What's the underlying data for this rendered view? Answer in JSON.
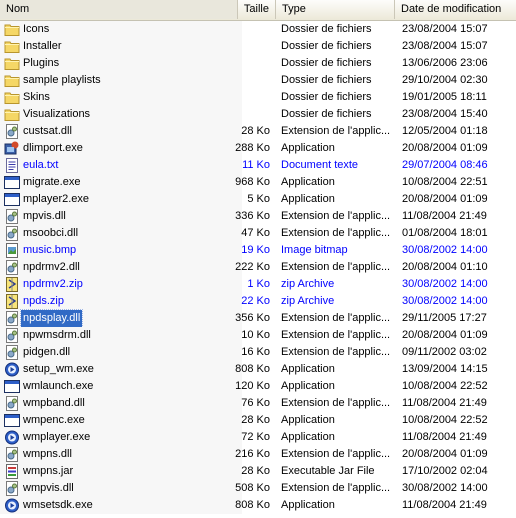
{
  "header": {
    "name": "Nom",
    "size": "Taille",
    "type": "Type",
    "date": "Date de modification"
  },
  "rows": [
    {
      "name": "Icons",
      "size": "",
      "type": "Dossier de fichiers",
      "date": "23/08/2004 15:07",
      "icon": "folder-icon",
      "blue": false,
      "selected": false
    },
    {
      "name": "Installer",
      "size": "",
      "type": "Dossier de fichiers",
      "date": "23/08/2004 15:07",
      "icon": "folder-icon",
      "blue": false,
      "selected": false
    },
    {
      "name": "Plugins",
      "size": "",
      "type": "Dossier de fichiers",
      "date": "13/06/2006 23:06",
      "icon": "folder-icon",
      "blue": false,
      "selected": false
    },
    {
      "name": "sample playlists",
      "size": "",
      "type": "Dossier de fichiers",
      "date": "29/10/2004 02:30",
      "icon": "folder-icon",
      "blue": false,
      "selected": false
    },
    {
      "name": "Skins",
      "size": "",
      "type": "Dossier de fichiers",
      "date": "19/01/2005 18:11",
      "icon": "folder-icon",
      "blue": false,
      "selected": false
    },
    {
      "name": "Visualizations",
      "size": "",
      "type": "Dossier de fichiers",
      "date": "23/08/2004 15:40",
      "icon": "folder-icon",
      "blue": false,
      "selected": false
    },
    {
      "name": "custsat.dll",
      "size": "28 Ko",
      "type": "Extension de l'applic...",
      "date": "12/05/2004 01:18",
      "icon": "dll-icon",
      "blue": false,
      "selected": false
    },
    {
      "name": "dlimport.exe",
      "size": "288 Ko",
      "type": "Application",
      "date": "20/08/2004 01:09",
      "icon": "exe-installer-icon",
      "blue": false,
      "selected": false
    },
    {
      "name": "eula.txt",
      "size": "11 Ko",
      "type": "Document texte",
      "date": "29/07/2004 08:46",
      "icon": "text-file-icon",
      "blue": true,
      "selected": false
    },
    {
      "name": "migrate.exe",
      "size": "968 Ko",
      "type": "Application",
      "date": "10/08/2004 22:51",
      "icon": "application-window-icon",
      "blue": false,
      "selected": false
    },
    {
      "name": "mplayer2.exe",
      "size": "5 Ko",
      "type": "Application",
      "date": "20/08/2004 01:09",
      "icon": "application-window-icon",
      "blue": false,
      "selected": false
    },
    {
      "name": "mpvis.dll",
      "size": "336 Ko",
      "type": "Extension de l'applic...",
      "date": "11/08/2004 21:49",
      "icon": "dll-icon",
      "blue": false,
      "selected": false
    },
    {
      "name": "msoobci.dll",
      "size": "47 Ko",
      "type": "Extension de l'applic...",
      "date": "01/08/2004 18:01",
      "icon": "dll-icon",
      "blue": false,
      "selected": false
    },
    {
      "name": "music.bmp",
      "size": "19 Ko",
      "type": "Image bitmap",
      "date": "30/08/2002 14:00",
      "icon": "bitmap-icon",
      "blue": true,
      "selected": false
    },
    {
      "name": "npdrmv2.dll",
      "size": "222 Ko",
      "type": "Extension de l'applic...",
      "date": "20/08/2004 01:10",
      "icon": "dll-icon",
      "blue": false,
      "selected": false
    },
    {
      "name": "npdrmv2.zip",
      "size": "1 Ko",
      "type": "zip Archive",
      "date": "30/08/2002 14:00",
      "icon": "zip-archive-icon",
      "blue": true,
      "selected": false
    },
    {
      "name": "npds.zip",
      "size": "22 Ko",
      "type": "zip Archive",
      "date": "30/08/2002 14:00",
      "icon": "zip-archive-icon",
      "blue": true,
      "selected": false
    },
    {
      "name": "npdsplay.dll",
      "size": "356 Ko",
      "type": "Extension de l'applic...",
      "date": "29/11/2005 17:27",
      "icon": "dll-icon",
      "blue": false,
      "selected": true
    },
    {
      "name": "npwmsdrm.dll",
      "size": "10 Ko",
      "type": "Extension de l'applic...",
      "date": "20/08/2004 01:09",
      "icon": "dll-icon",
      "blue": false,
      "selected": false
    },
    {
      "name": "pidgen.dll",
      "size": "16 Ko",
      "type": "Extension de l'applic...",
      "date": "09/11/2002 03:02",
      "icon": "dll-icon",
      "blue": false,
      "selected": false
    },
    {
      "name": "setup_wm.exe",
      "size": "808 Ko",
      "type": "Application",
      "date": "13/09/2004 14:15",
      "icon": "media-player-icon",
      "blue": false,
      "selected": false
    },
    {
      "name": "wmlaunch.exe",
      "size": "120 Ko",
      "type": "Application",
      "date": "10/08/2004 22:52",
      "icon": "application-window-icon",
      "blue": false,
      "selected": false
    },
    {
      "name": "wmpband.dll",
      "size": "76 Ko",
      "type": "Extension de l'applic...",
      "date": "11/08/2004 21:49",
      "icon": "dll-icon",
      "blue": false,
      "selected": false
    },
    {
      "name": "wmpenc.exe",
      "size": "28 Ko",
      "type": "Application",
      "date": "10/08/2004 22:52",
      "icon": "application-window-icon",
      "blue": false,
      "selected": false
    },
    {
      "name": "wmplayer.exe",
      "size": "72 Ko",
      "type": "Application",
      "date": "11/08/2004 21:49",
      "icon": "media-player-icon",
      "blue": false,
      "selected": false
    },
    {
      "name": "wmpns.dll",
      "size": "216 Ko",
      "type": "Extension de l'applic...",
      "date": "20/08/2004 01:09",
      "icon": "dll-icon",
      "blue": false,
      "selected": false
    },
    {
      "name": "wmpns.jar",
      "size": "28 Ko",
      "type": "Executable Jar File",
      "date": "17/10/2002 02:04",
      "icon": "jar-file-icon",
      "blue": false,
      "selected": false
    },
    {
      "name": "wmpvis.dll",
      "size": "508 Ko",
      "type": "Extension de l'applic...",
      "date": "30/08/2002 14:00",
      "icon": "dll-icon",
      "blue": false,
      "selected": false
    },
    {
      "name": "wmsetsdk.exe",
      "size": "808 Ko",
      "type": "Application",
      "date": "11/08/2004 21:49",
      "icon": "media-player-icon",
      "blue": false,
      "selected": false
    }
  ],
  "colors": {
    "compressed_text": "#0000ff",
    "selection": "#316ac5",
    "sorted_column": "#f7f7f7"
  }
}
